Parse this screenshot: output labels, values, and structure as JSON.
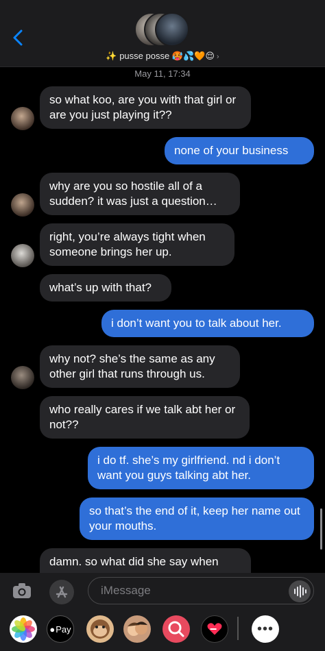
{
  "header": {
    "group_name": "✨ pusse posse 🥵💦🧡😌",
    "back_icon": "chevron-left-icon"
  },
  "timestamp": "May 11, 17:34",
  "messages": [
    {
      "dir": "in",
      "text": "so what koo, are you with that girl or are you just playing it??",
      "avatar": true
    },
    {
      "dir": "out",
      "text": "none of your business"
    },
    {
      "dir": "in",
      "text": "why are you so hostile all of a sudden? it was just a question…",
      "avatar": true
    },
    {
      "dir": "in",
      "text": "right, you’re always tight when someone brings her up.",
      "avatar": true
    },
    {
      "dir": "in",
      "text": "what’s up with that?",
      "avatar": false
    },
    {
      "dir": "out",
      "text": "i don’t want you to talk about her."
    },
    {
      "dir": "in",
      "text": "why not? she’s the same as any other girl that runs through us.",
      "avatar": true
    },
    {
      "dir": "in",
      "text": "who really cares if we talk abt her or not??",
      "avatar": false
    },
    {
      "dir": "out",
      "text": "i do tf. she’s my girlfriend. nd i don’t want you guys talking abt her."
    },
    {
      "dir": "out",
      "text": "so that’s the end of it, keep her name out your mouths."
    },
    {
      "dir": "in",
      "text": "damn. so what did she say when",
      "avatar": false
    }
  ],
  "composer": {
    "placeholder": "iMessage"
  },
  "apps": {
    "pay_label": "Pay",
    "more_label": "•••"
  },
  "colors": {
    "outgoing": "#2f6fd8",
    "incoming": "#262629",
    "accent": "#0a84ff"
  }
}
